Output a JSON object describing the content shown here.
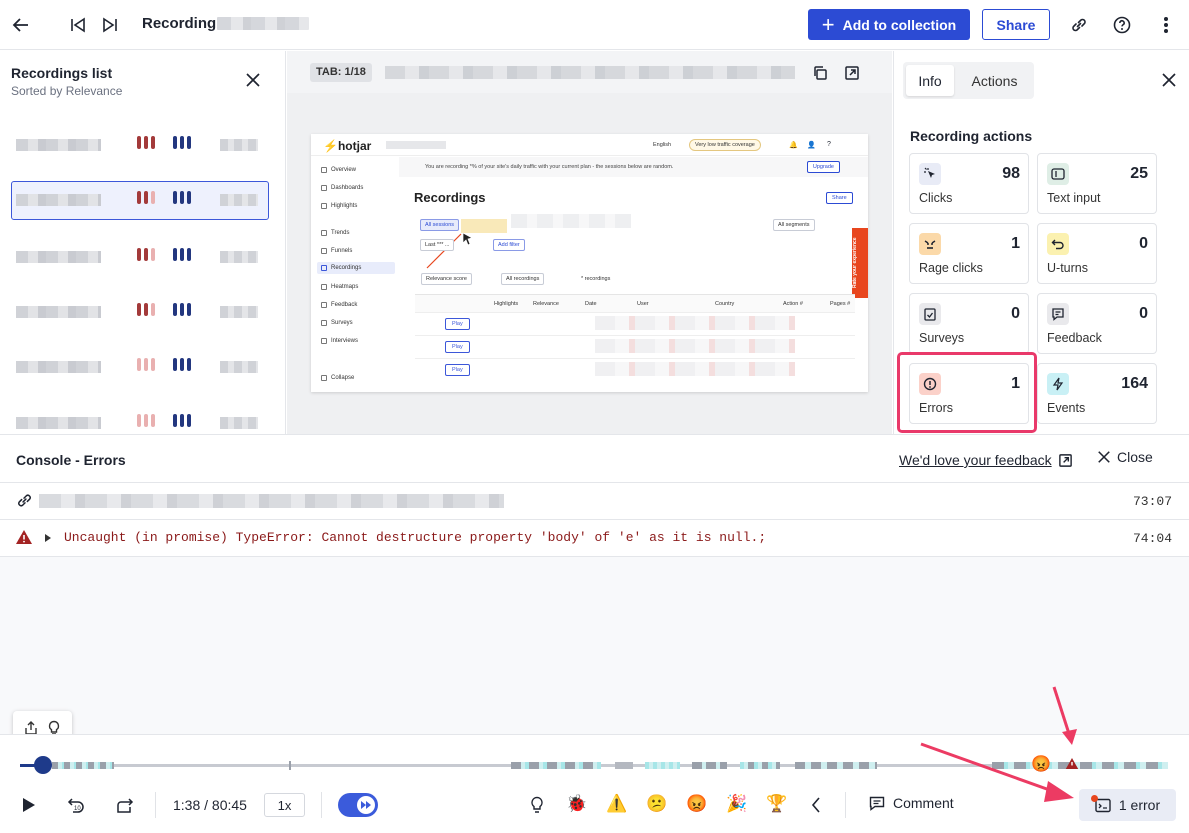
{
  "topbar": {
    "title": "Recording",
    "add_label": "Add to collection",
    "share_label": "Share"
  },
  "recordings_list": {
    "title": "Recordings list",
    "subtitle": "Sorted by Relevance"
  },
  "viewer": {
    "tab_label": "TAB: 1/18",
    "preview": {
      "logo": "hotjar",
      "language": "English",
      "coverage": "Very low traffic coverage",
      "banner": "You are recording *% of your site's daily traffic with your current plan - the sessions below are random.",
      "upgrade": "Upgrade",
      "heading": "Recordings",
      "share": "Share",
      "rate": "Rate your experience",
      "nav": [
        "Overview",
        "Dashboards",
        "Highlights",
        "Trends",
        "Funnels",
        "Recordings",
        "Heatmaps",
        "Feedback",
        "Surveys",
        "Interviews",
        "Collapse"
      ],
      "chips": {
        "all_sessions": "All sessions",
        "last": "Last *** ...",
        "add_filter": "Add filter",
        "all_segments": "All segments",
        "relevance": "Relevance score",
        "all_recordings": "All recordings",
        "count": "* recordings"
      },
      "columns": [
        "Highlights",
        "Relevance",
        "Date",
        "User",
        "Country",
        "Action #",
        "Pages #"
      ],
      "play": "Play"
    }
  },
  "info_panel": {
    "tabs": [
      "Info",
      "Actions"
    ],
    "section_title": "Recording actions",
    "cards": [
      {
        "label": "Clicks",
        "value": "98",
        "icon": "click-icon",
        "color": "#e8ebf6"
      },
      {
        "label": "Text input",
        "value": "25",
        "icon": "text-input-icon",
        "color": "#dfeee6"
      },
      {
        "label": "Rage clicks",
        "value": "1",
        "icon": "rage-face-icon",
        "color": "#fbd9a9"
      },
      {
        "label": "U-turns",
        "value": "0",
        "icon": "u-turn-icon",
        "color": "#fbf1b0"
      },
      {
        "label": "Surveys",
        "value": "0",
        "icon": "clipboard-icon",
        "color": "#e9e9ec"
      },
      {
        "label": "Feedback",
        "value": "0",
        "icon": "feedback-icon",
        "color": "#e9e9ec"
      },
      {
        "label": "Errors",
        "value": "1",
        "icon": "error-icon",
        "color": "#fbd1c9"
      },
      {
        "label": "Events",
        "value": "164",
        "icon": "lightning-icon",
        "color": "#c9f0f5"
      }
    ]
  },
  "console": {
    "title": "Console - Errors",
    "feedback_link": "We'd love your feedback",
    "close_label": "Close",
    "url_time": "73:07",
    "error_text": "Uncaught (in promise) TypeError: Cannot destructure property 'body' of 'e' as it is null.;",
    "error_time": "74:04"
  },
  "controls": {
    "time": "1:38 / 80:45",
    "speed": "1x",
    "comment": "Comment",
    "errors": "1 error"
  },
  "colors": {
    "primary": "#2c4bd4",
    "highlight": "#e9396a",
    "error_red": "#8b1a1a"
  }
}
